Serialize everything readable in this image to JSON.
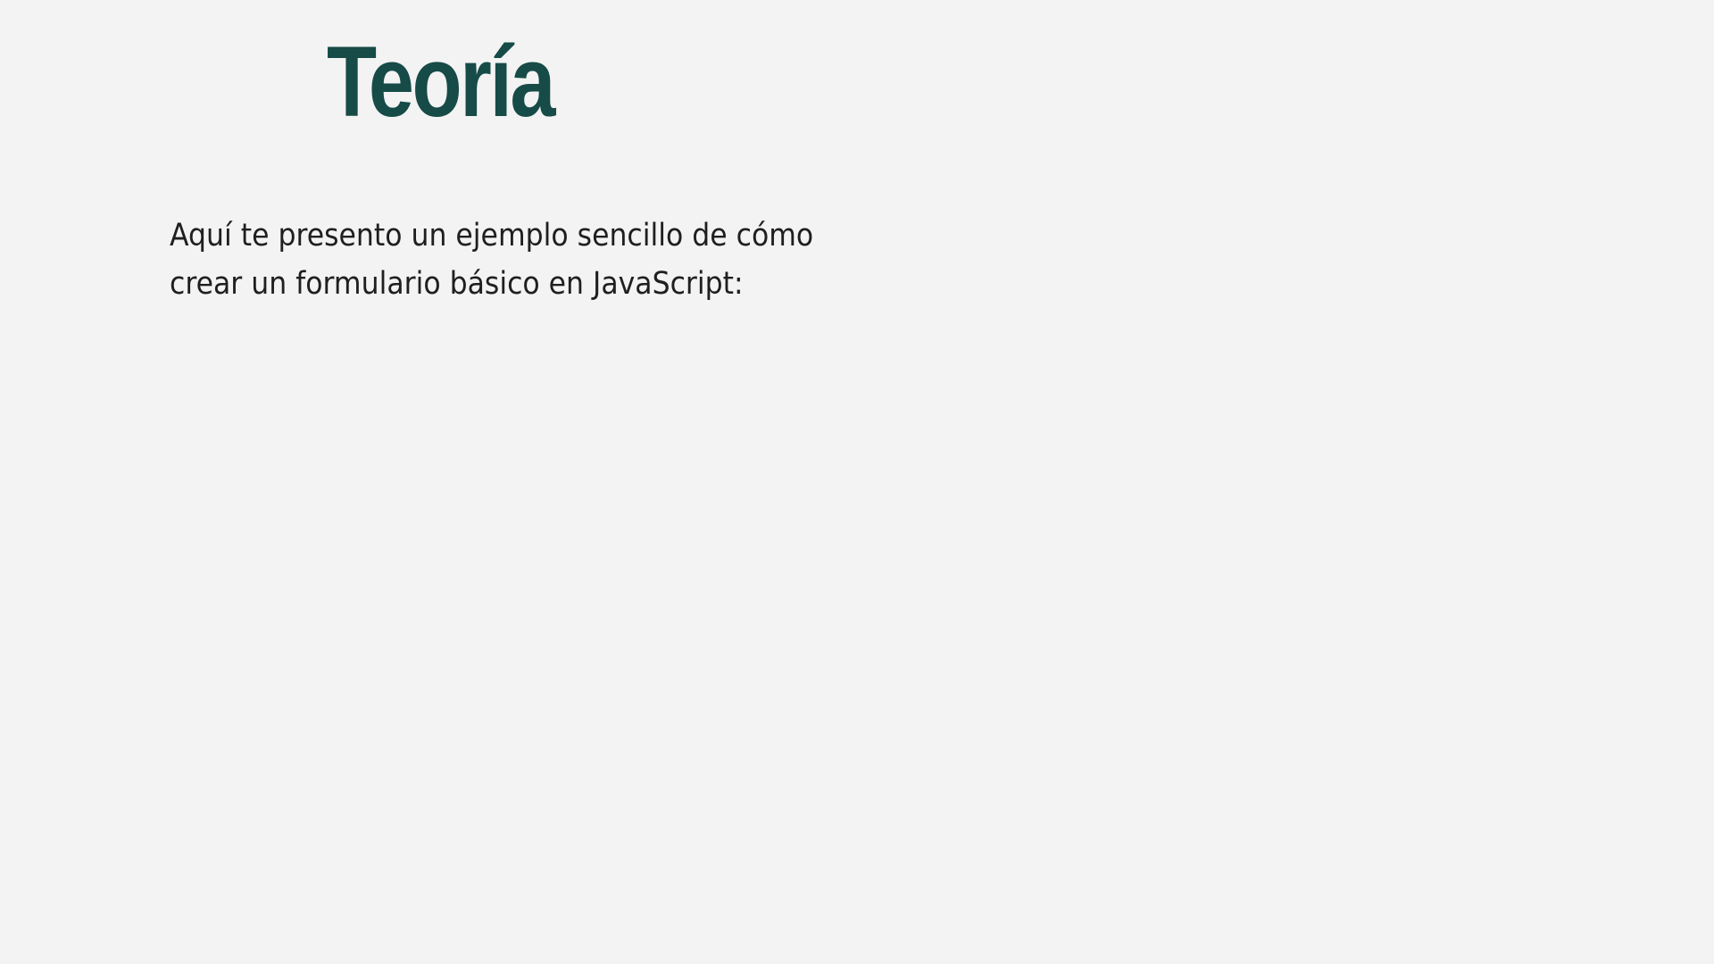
{
  "slide": {
    "title": "Teoría",
    "body_lines": [
      "Aquí te presento un ejemplo sencillo de cómo",
      "crear un formulario básico en JavaScript:"
    ]
  },
  "colors": {
    "background": "#f3f3f3",
    "title": "#164b47",
    "body_text": "#1f1f1f"
  }
}
